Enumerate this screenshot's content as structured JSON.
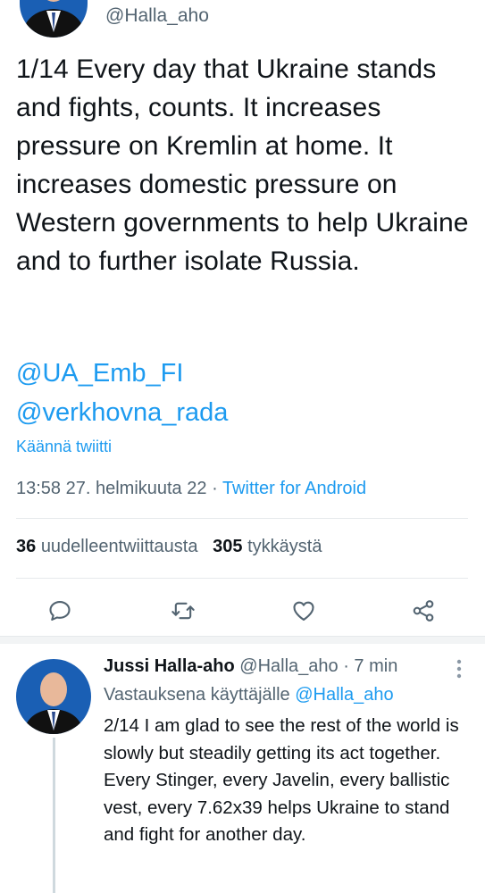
{
  "main_tweet": {
    "handle": "@Halla_aho",
    "text": "1/14 Every day that Ukraine stands and fights, counts. It increases pressure on Kremlin at home. It increases domestic pressure on Western governments to help Ukraine and to further isolate Russia.",
    "mentions": [
      "@UA_Emb_FI",
      "@verkhovna_rada"
    ],
    "translate_label": "Käännä twiitti",
    "time": "13:58 27. helmikuuta 22",
    "separator": "·",
    "source": "Twitter for Android",
    "retweets_count": "36",
    "retweets_label": "uudelleentwiittausta",
    "likes_count": "305",
    "likes_label": "tykkäystä"
  },
  "actions": [
    "reply-icon",
    "retweet-icon",
    "like-icon",
    "share-icon"
  ],
  "reply_tweet": {
    "name": "Jussi Halla-aho",
    "handle": "@Halla_aho",
    "age": "· 7 min",
    "reply_to_prefix": "Vastauksena käyttäjälle",
    "reply_to_handle": "@Halla_aho",
    "text": "2/14 I am glad to see the rest of the world is slowly but steadily getting its act together. Every Stinger, every Javelin, every ballistic vest, every 7.62x39 helps Ukraine to stand and fight for another day."
  },
  "colors": {
    "link": "#1d9bf0",
    "muted": "#536471",
    "text": "#0f1419"
  }
}
